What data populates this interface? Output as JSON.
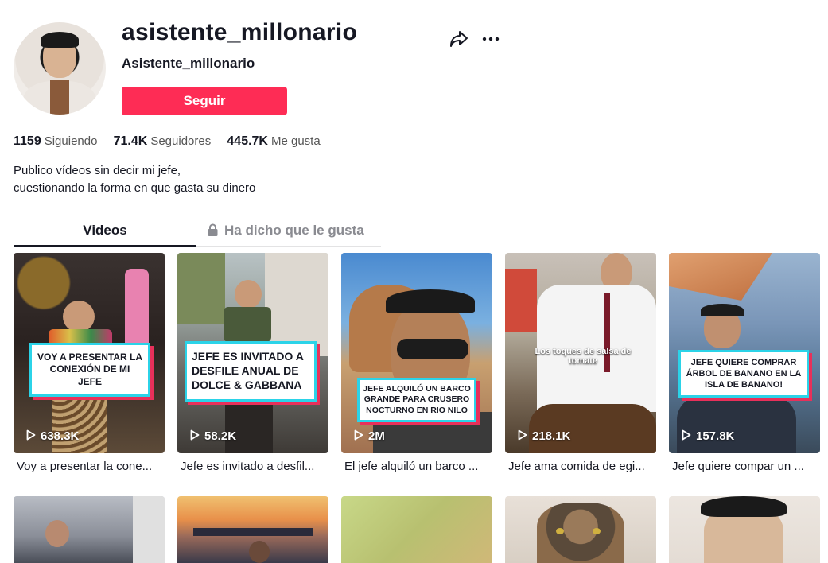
{
  "profile": {
    "username": "asistente_millonario",
    "nickname": "Asistente_millonario",
    "follow_label": "Seguir",
    "stats": [
      {
        "value": "1159",
        "label": "Siguiendo"
      },
      {
        "value": "71.4K",
        "label": "Seguidores"
      },
      {
        "value": "445.7K",
        "label": "Me gusta"
      }
    ],
    "bio_line1": "Publico vídeos sin decir mi jefe,",
    "bio_line2": "cuestionando la forma en que gasta su dinero"
  },
  "tabs": {
    "videos": "Videos",
    "liked": "Ha dicho que le gusta"
  },
  "videos": [
    {
      "overlay": "VOY A PRESENTAR LA CONEXIÓN DE MI JEFE",
      "views": "638.3K",
      "title": "Voy a presentar la cone..."
    },
    {
      "overlay": "JEFE ES INVITADO A DESFILE ANUAL DE DOLCE & GABBANA",
      "views": "58.2K",
      "title": "Jefe es invitado a desfil..."
    },
    {
      "overlay": "JEFE ALQUILÓ UN BARCO GRANDE PARA CRUSERO NOCTURNO EN RIO NILO",
      "views": "2M",
      "title": "El jefe alquiló un barco ..."
    },
    {
      "overlay": "Los toques de salsa de tomate",
      "views": "218.1K",
      "title": "Jefe ama comida de egi..."
    },
    {
      "overlay": "JEFE QUIERE COMPRAR ÁRBOL  DE BANANO EN LA ISLA DE BANANO!",
      "views": "157.8K",
      "title": "Jefe quiere compar un ..."
    }
  ],
  "colors": {
    "accent": "#fe2c55",
    "caption_border": "#2bd3e8",
    "caption_shadow": "#e8305a"
  }
}
